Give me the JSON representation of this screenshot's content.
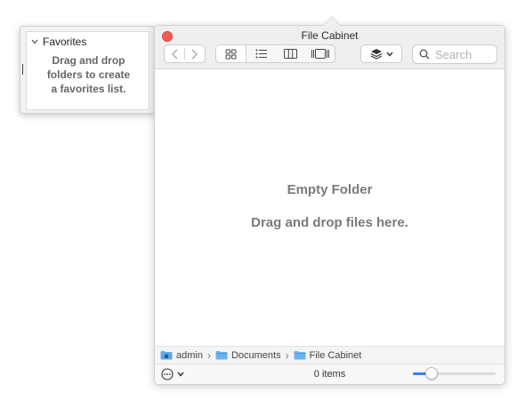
{
  "favorites": {
    "header": "Favorites",
    "empty_lines": [
      "Drag and drop",
      "folders to create",
      "a favorites list."
    ]
  },
  "window": {
    "title": "File Cabinet",
    "close_color": "#f25c55"
  },
  "toolbar": {
    "views": [
      "icon-view",
      "list-view",
      "column-view",
      "gallery-view"
    ],
    "active_view": "icon-view",
    "search_placeholder": "Search"
  },
  "content": {
    "empty_title": "Empty Folder",
    "empty_subtitle": "Drag and drop files here."
  },
  "pathbar": {
    "items": [
      {
        "label": "admin",
        "icon": "home-folder-icon"
      },
      {
        "label": "Documents",
        "icon": "folder-icon"
      },
      {
        "label": "File Cabinet",
        "icon": "folder-icon"
      }
    ]
  },
  "statusbar": {
    "item_count": "0 items",
    "icon_size_level": 0.18,
    "accent_color": "#3b7ef0"
  }
}
